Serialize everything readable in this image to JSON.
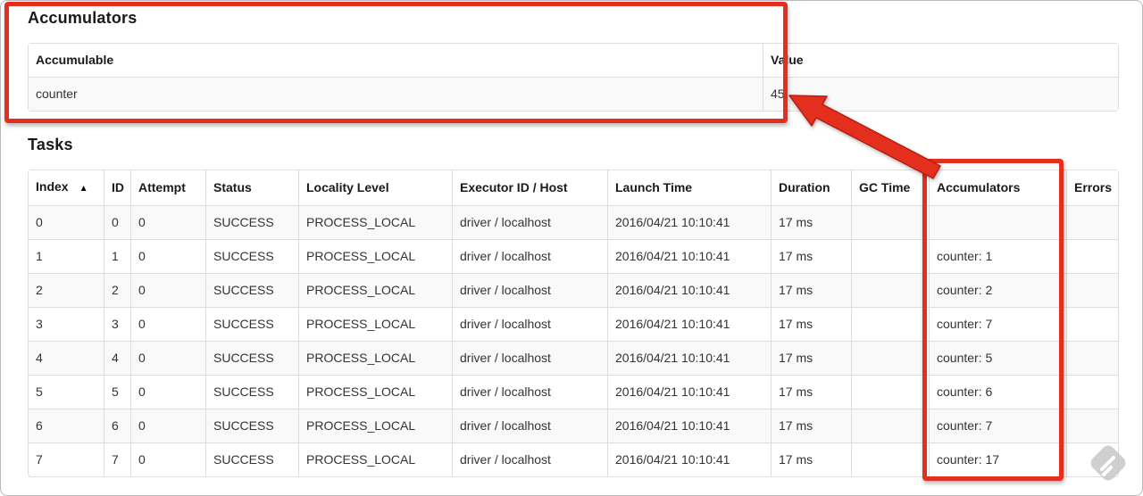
{
  "accumulators_section": {
    "title": "Accumulators",
    "table": {
      "headers": [
        "Accumulable",
        "Value"
      ],
      "rows": [
        [
          "counter",
          "45"
        ]
      ]
    }
  },
  "tasks_section": {
    "title": "Tasks",
    "table": {
      "headers": [
        "Index",
        "ID",
        "Attempt",
        "Status",
        "Locality Level",
        "Executor ID / Host",
        "Launch Time",
        "Duration",
        "GC Time",
        "Accumulators",
        "Errors"
      ],
      "sort_column": "Index",
      "sort_direction_icon": "▲",
      "rows": [
        [
          "0",
          "0",
          "0",
          "SUCCESS",
          "PROCESS_LOCAL",
          "driver / localhost",
          "2016/04/21 10:10:41",
          "17 ms",
          "",
          "",
          ""
        ],
        [
          "1",
          "1",
          "0",
          "SUCCESS",
          "PROCESS_LOCAL",
          "driver / localhost",
          "2016/04/21 10:10:41",
          "17 ms",
          "",
          "counter: 1",
          ""
        ],
        [
          "2",
          "2",
          "0",
          "SUCCESS",
          "PROCESS_LOCAL",
          "driver / localhost",
          "2016/04/21 10:10:41",
          "17 ms",
          "",
          "counter: 2",
          ""
        ],
        [
          "3",
          "3",
          "0",
          "SUCCESS",
          "PROCESS_LOCAL",
          "driver / localhost",
          "2016/04/21 10:10:41",
          "17 ms",
          "",
          "counter: 7",
          ""
        ],
        [
          "4",
          "4",
          "0",
          "SUCCESS",
          "PROCESS_LOCAL",
          "driver / localhost",
          "2016/04/21 10:10:41",
          "17 ms",
          "",
          "counter: 5",
          ""
        ],
        [
          "5",
          "5",
          "0",
          "SUCCESS",
          "PROCESS_LOCAL",
          "driver / localhost",
          "2016/04/21 10:10:41",
          "17 ms",
          "",
          "counter: 6",
          ""
        ],
        [
          "6",
          "6",
          "0",
          "SUCCESS",
          "PROCESS_LOCAL",
          "driver / localhost",
          "2016/04/21 10:10:41",
          "17 ms",
          "",
          "counter: 7",
          ""
        ],
        [
          "7",
          "7",
          "0",
          "SUCCESS",
          "PROCESS_LOCAL",
          "driver / localhost",
          "2016/04/21 10:10:41",
          "17 ms",
          "",
          "counter: 17",
          ""
        ]
      ]
    }
  },
  "annotations": {
    "color": "#e42f1e"
  },
  "watermark_icon": "skitch-diamond-logo"
}
